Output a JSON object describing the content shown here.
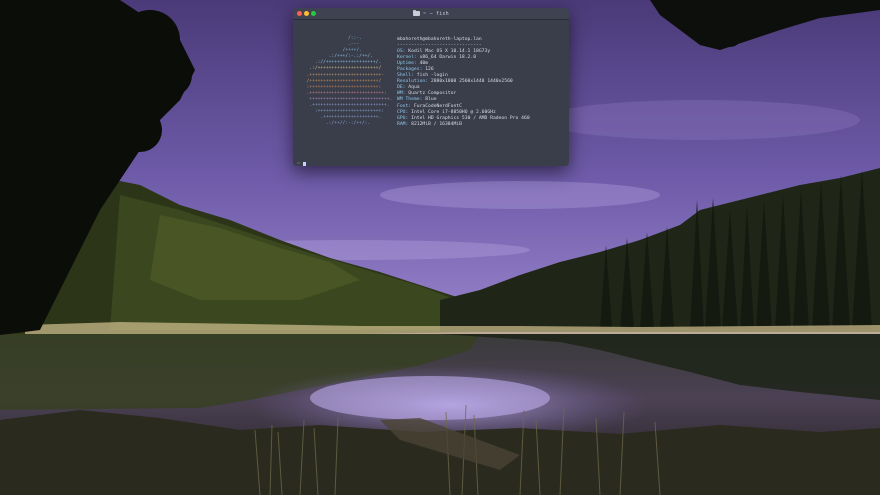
{
  "terminal": {
    "title": "~ — fish",
    "logo_lines": [
      {
        "text": "                 /::-.",
        "color": "#7fb8d9"
      },
      {
        "text": "                 .---",
        "color": "#7fb8d9"
      },
      {
        "text": "               /++++/.",
        "color": "#7fb8d9"
      },
      {
        "text": "          .:/+++/:-.:/++/.",
        "color": "#8fc7ea"
      },
      {
        "text": "     .://++++++++++++++++++/.",
        "color": "#8fc7ea"
      },
      {
        "text": "   .:/++++++++++++++++++++++/",
        "color": "#d8c58e"
      },
      {
        "text": "  .++++++++++++++++++++++++++-",
        "color": "#d8a36a"
      },
      {
        "text": "  /+++++++++++++++++++++++++/",
        "color": "#d99455"
      },
      {
        "text": "  :+++++++++++++++++++++++++:",
        "color": "#d98a4c"
      },
      {
        "text": "  .+++++++++++++++++++++++++++:",
        "color": "#d58a8f"
      },
      {
        "text": "   +++++++++++++++++++++++++++++.",
        "color": "#b890c8"
      },
      {
        "text": "   .+++++++++++++++++++++++++++.",
        "color": "#9aa4d6"
      },
      {
        "text": "     :+++++++++++++++++++++++:",
        "color": "#8fa7d9"
      },
      {
        "text": "       .++++++++++++++++++++.",
        "color": "#8fa7d9"
      },
      {
        "text": "         .:/++//:-:/++/:.",
        "color": "#8fa7d9"
      }
    ],
    "info": [
      {
        "key": "",
        "value": "mbahoreth@mbahoreth-laptop.lan"
      },
      {
        "key": "",
        "value": "------------------------------"
      },
      {
        "key": "OS: ",
        "value": "Kodil Mac OS X 10.14.1 18G73y"
      },
      {
        "key": "Kernel: ",
        "value": "x86_64 Darwin 18.2.0"
      },
      {
        "key": "Uptime: ",
        "value": "40m"
      },
      {
        "key": "Packages: ",
        "value": "126"
      },
      {
        "key": "Shell: ",
        "value": "fish -login"
      },
      {
        "key": "Resolution: ",
        "value": "2880x1800 2560x1440 1440x2560"
      },
      {
        "key": "DE: ",
        "value": "Aqua"
      },
      {
        "key": "WM: ",
        "value": "Quartz Compositor"
      },
      {
        "key": "WM Theme: ",
        "value": "Blue"
      },
      {
        "key": "Font: ",
        "value": "FuraCodeNerdFontC"
      },
      {
        "key": "CPU: ",
        "value": "Intel Core i7-8850HQ @ 2.60GHz"
      },
      {
        "key": "GPU: ",
        "value": "Intel HD Graphics 530 / AMD Radeon Pro 460"
      },
      {
        "key": "RAM: ",
        "value": "8212MiB / 16384MiB"
      }
    ],
    "prompt_symbol": "~"
  }
}
